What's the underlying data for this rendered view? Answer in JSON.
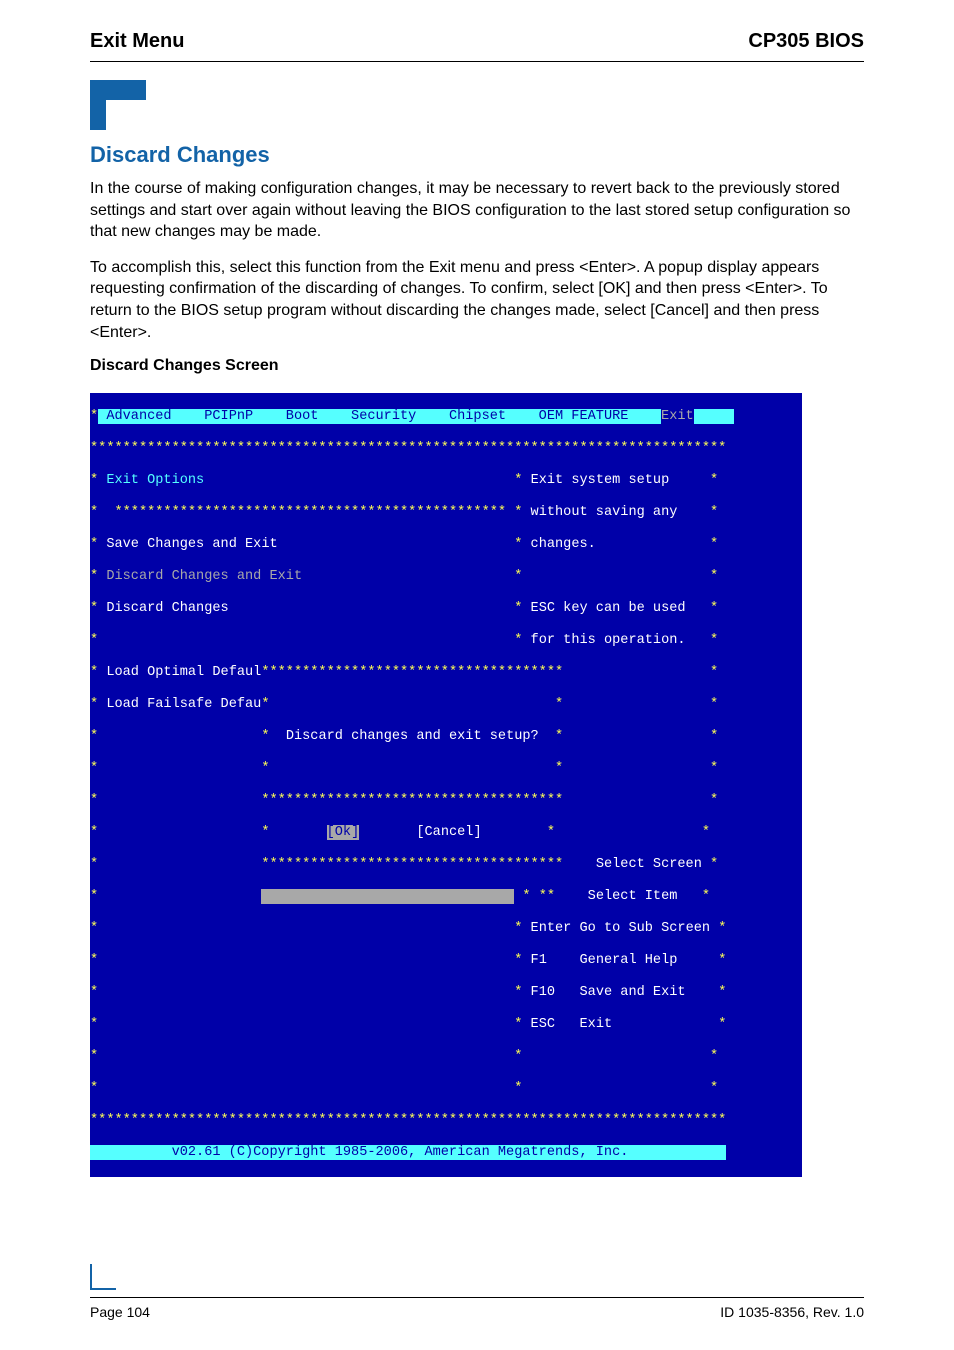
{
  "header": {
    "left": "Exit Menu",
    "right": "CP305 BIOS"
  },
  "section": {
    "title": "Discard Changes",
    "p1": "In the course of making configuration changes, it may be necessary to revert back to the previously stored settings and start over again without leaving the BIOS configuration to the last stored setup configuration so that new changes may be made.",
    "p2": "To accomplish this, select this function from the Exit menu and press <Enter>. A popup display appears requesting confirmation of the discarding of changes. To confirm, select [OK] and then press <Enter>. To return to the BIOS setup program without discarding the changes made, select [Cancel] and then press <Enter>.",
    "sub": "Discard Changes Screen"
  },
  "bios": {
    "tabs": {
      "items": " Advanced    PCIPnP    Boot    Security    Chipset    OEM FEATURE    ",
      "active": "Exit"
    },
    "starsFull": "******************************************************************************",
    "starsHalf": "************************************************",
    "menu": {
      "exitOptions": "Exit Options",
      "saveExit": "Save Changes and Exit",
      "discardExit": "Discard Changes and Exit",
      "discard": "Discard Changes",
      "loadOptimal": "Load Optimal Defaul",
      "loadFailsafe": "Load Failsafe Defau"
    },
    "help": {
      "l1": "Exit system setup",
      "l2": "without saving any",
      "l3": "changes.",
      "l4": "ESC key can be used",
      "l5": "for this operation.",
      "navSelScreen": "Select Screen",
      "navSelItem": "Select Item",
      "navEnter": "Go to Sub Screen",
      "navF1": "General Help",
      "navF10": "Save and Exit",
      "navESC": "Exit",
      "enter": "Enter",
      "f1": "F1",
      "f10": "F10",
      "esc": "ESC"
    },
    "dialog": {
      "starsBox": "*************************************",
      "msg": "Discard changes and exit setup?",
      "ok": "[Ok]",
      "cancel": "[Cancel]"
    },
    "footer": "v02.61 (C)Copyright 1985-2006, American Megatrends, Inc."
  },
  "footer": {
    "left": "Page 104",
    "right": "ID 1035-8356, Rev. 1.0"
  }
}
